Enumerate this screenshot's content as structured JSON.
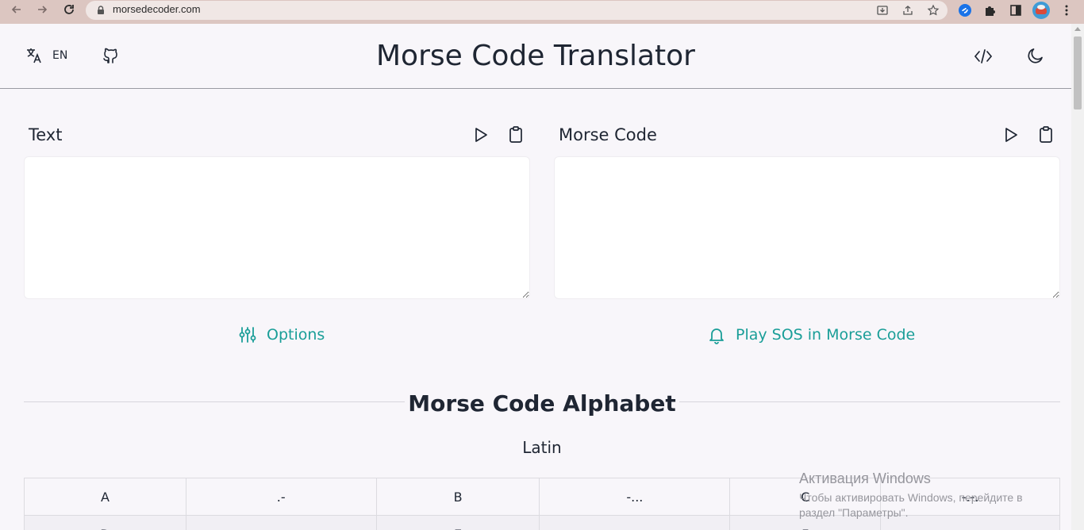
{
  "browser": {
    "url": "morsedecoder.com"
  },
  "header": {
    "language_code": "EN",
    "title": "Morse Code Translator"
  },
  "text_panel": {
    "label": "Text",
    "value": "",
    "placeholder": ""
  },
  "morse_panel": {
    "label": "Morse Code",
    "value": "",
    "placeholder": ""
  },
  "actions": {
    "options_label": "Options",
    "sos_label": "Play SOS in Morse Code"
  },
  "alphabet": {
    "title": "Morse Code Alphabet",
    "subtitle": "Latin",
    "rows": [
      [
        "A",
        ".-",
        "B",
        "-...",
        "C",
        "-.-."
      ],
      [
        "D",
        "-..",
        "E",
        ".",
        "F",
        "..-."
      ]
    ]
  },
  "watermark": {
    "title": "Активация Windows",
    "line1": "Чтобы активировать Windows, перейдите в",
    "line2": "раздел \"Параметры\"."
  },
  "colors": {
    "accent": "#1a9e98",
    "text": "#1f2633",
    "background": "#f8f6fa",
    "chrome": "#dcc6c1"
  },
  "icons": {
    "back": "arrow-left-icon",
    "forward": "arrow-right-icon",
    "reload": "reload-icon",
    "language": "translate-icon",
    "github": "github-icon",
    "embed": "code-icon",
    "theme": "moon-icon",
    "play": "play-icon",
    "copy": "clipboard-icon",
    "options": "sliders-icon",
    "sos": "bell-icon"
  }
}
